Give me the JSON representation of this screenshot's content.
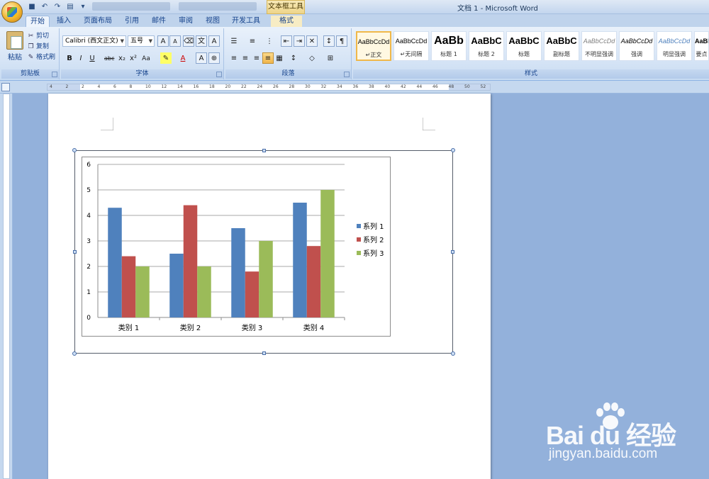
{
  "titlebar": {
    "context_tab": "文本框工具",
    "app_title": "文档 1 - Microsoft Word"
  },
  "ribbon_tabs": [
    {
      "label": "开始",
      "active": true
    },
    {
      "label": "插入"
    },
    {
      "label": "页面布局"
    },
    {
      "label": "引用"
    },
    {
      "label": "邮件"
    },
    {
      "label": "审阅"
    },
    {
      "label": "视图"
    },
    {
      "label": "开发工具"
    },
    {
      "label": "格式"
    }
  ],
  "clipboard": {
    "group_label": "剪贴板",
    "paste": "粘贴",
    "cut": "剪切",
    "copy": "复制",
    "format_painter": "格式刷"
  },
  "font": {
    "group_label": "字体",
    "font_name": "Calibri (西文正文)",
    "font_size": "五号"
  },
  "paragraph": {
    "group_label": "段落"
  },
  "styles": {
    "group_label": "样式",
    "items": [
      {
        "sample": "AaBbCcDd",
        "name": "↵正文"
      },
      {
        "sample": "AaBbCcDd",
        "name": "↵无间隔"
      },
      {
        "sample": "AaBb",
        "name": "标题 1"
      },
      {
        "sample": "AaBbC",
        "name": "标题 2"
      },
      {
        "sample": "AaBbC",
        "name": "标题"
      },
      {
        "sample": "AaBbC",
        "name": "副标题"
      },
      {
        "sample": "AaBbCcDd",
        "name": "不明显强调"
      },
      {
        "sample": "AaBbCcDd",
        "name": "强调"
      },
      {
        "sample": "AaBbCcDd",
        "name": "明显强调"
      },
      {
        "sample": "AaBbCcDd",
        "name": "要点"
      }
    ]
  },
  "ruler": {
    "numbers": [
      "4",
      "2",
      "2",
      "4",
      "6",
      "8",
      "10",
      "12",
      "14",
      "16",
      "18",
      "20",
      "22",
      "24",
      "26",
      "28",
      "30",
      "32",
      "34",
      "36",
      "38",
      "40",
      "42",
      "44",
      "46",
      "48",
      "50",
      "52"
    ]
  },
  "chart_data": {
    "type": "bar",
    "categories": [
      "类别 1",
      "类别 2",
      "类别 3",
      "类别 4"
    ],
    "series": [
      {
        "name": "系列 1",
        "values": [
          4.3,
          2.5,
          3.5,
          4.5
        ],
        "color": "#4f81bd"
      },
      {
        "name": "系列 2",
        "values": [
          2.4,
          4.4,
          1.8,
          2.8
        ],
        "color": "#c0504d"
      },
      {
        "name": "系列 3",
        "values": [
          2.0,
          2.0,
          3.0,
          5.0
        ],
        "color": "#9bbb59"
      }
    ],
    "ylim": [
      0,
      6
    ],
    "yticks": [
      "0",
      "1",
      "2",
      "3",
      "4",
      "5",
      "6"
    ],
    "grid": true,
    "legend": "right"
  },
  "watermark": {
    "brand": "Bai du 经验",
    "url": "jingyan.baidu.com"
  }
}
